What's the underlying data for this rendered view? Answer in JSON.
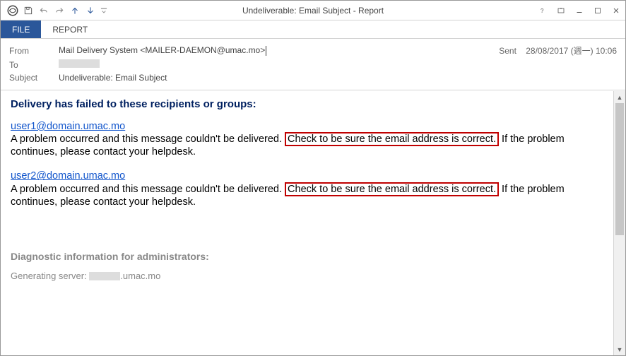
{
  "window": {
    "title": "Undeliverable: Email Subject - Report"
  },
  "tabs": {
    "file": "FILE",
    "report": "REPORT"
  },
  "header": {
    "from_label": "From",
    "from_value": "Mail Delivery System <MAILER-DAEMON@umac.mo>",
    "to_label": "To",
    "subject_label": "Subject",
    "subject_value": "Undeliverable: Email Subject",
    "sent_label": "Sent",
    "sent_value": "28/08/2017 (週一) 10:06"
  },
  "body": {
    "fail_heading": "Delivery has failed to these recipients or groups:",
    "recipients": [
      {
        "email": "user1@domain.umac.mo",
        "msg_pre": "A problem occurred and this message couldn't be delivered. ",
        "msg_hl": "Check to be sure the email address is correct.",
        "msg_post": " If the problem continues, please contact your helpdesk."
      },
      {
        "email": "user2@domain.umac.mo",
        "msg_pre": "A problem occurred and this message couldn't be delivered. ",
        "msg_hl": "Check to be sure the email address is correct.",
        "msg_post": " If the problem continues, please contact your helpdesk."
      }
    ],
    "diag_heading": "Diagnostic information for administrators:",
    "diag_server_pre": "Generating server: ",
    "diag_server_post": ".umac.mo"
  }
}
